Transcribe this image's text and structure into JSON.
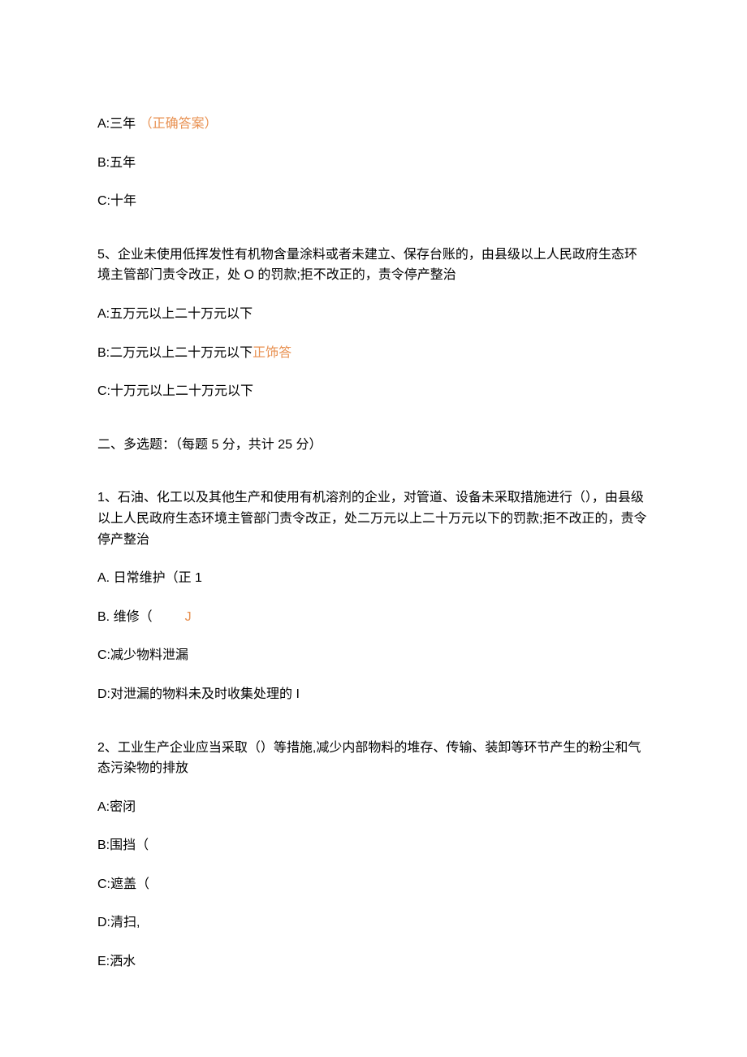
{
  "q4_options": {
    "a_prefix": "A:三年",
    "a_suffix": "（正确答案）",
    "b": "B:五年",
    "c": "C:十年"
  },
  "q5": {
    "text": "5、企业未使用低挥发性有机物含量涂料或者未建立、保存台账的，由县级以上人民政府生态环境主管部门责令改正，处 O 的罚款;拒不改正的，责令停产整治",
    "options": {
      "a": "A:五万元以上二十万元以下",
      "b_prefix": "B:二万元以上二十万元以下",
      "b_suffix": "正饰答",
      "c": "C:十万元以上二十万元以下"
    }
  },
  "section2_header": "二、多选题：（每题 5 分，共计 25 分）",
  "mq1": {
    "text": "1、石油、化工以及其他生产和使用有机溶剂的企业，对管道、设备未采取措施进行（），由县级以上人民政府生态环境主管部门责令改正，处二万元以上二十万元以下的罚款;拒不改正的，责令停产整治",
    "options": {
      "a": "A. 日常维护（正 1",
      "b_prefix": "B. 维修（",
      "b_j": "J",
      "c": "C:减少物料泄漏",
      "d": "D:对泄漏的物料未及时收集处理的 I"
    }
  },
  "mq2": {
    "text": "2、工业生产企业应当采取（）等措施,减少内部物料的堆存、传输、装卸等环节产生的粉尘和气态污染物的排放",
    "options": {
      "a": "A:密闭",
      "b": "B:围挡（",
      "c": "C:遮盖（",
      "d": "D:清扫,",
      "e": "E:洒水"
    }
  }
}
